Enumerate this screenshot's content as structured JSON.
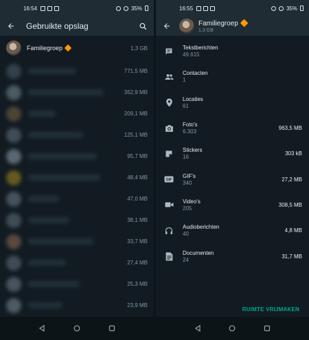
{
  "left": {
    "status_time": "16:54",
    "battery": "35%",
    "title": "Gebruikte opslag",
    "rows": [
      {
        "name": "Familiegroep",
        "emoji": "🔶",
        "size": "1,3 GB"
      },
      {
        "size": "771,5 MB",
        "blur": "#3b4a55"
      },
      {
        "size": "352,9 MB",
        "blur": "#5a6b72"
      },
      {
        "size": "209,1 MB",
        "blur": "#5c4e3a"
      },
      {
        "size": "125,1 MB",
        "blur": "#4c5a63"
      },
      {
        "size": "95,7 MB",
        "blur": "#6d7a86"
      },
      {
        "size": "48,4 MB",
        "blur": "#7a6a1e"
      },
      {
        "size": "47,0 MB",
        "blur": "#54616b"
      },
      {
        "size": "38,1 MB",
        "blur": "#4a5862"
      },
      {
        "size": "33,7 MB",
        "blur": "#6b5446"
      },
      {
        "size": "27,4 MB",
        "blur": "#4b5763"
      },
      {
        "size": "25,3 MB",
        "blur": "#55616c"
      },
      {
        "size": "23,9 MB",
        "blur": "#5c6a74"
      }
    ]
  },
  "right": {
    "status_time": "16:55",
    "battery": "35%",
    "title": "Familiegroep",
    "emoji": "🔶",
    "subtitle": "1,3 GB",
    "items": [
      {
        "icon": "message-icon",
        "label": "Tekstberichten",
        "count": "49.615",
        "size": ""
      },
      {
        "icon": "contacts-icon",
        "label": "Contacten",
        "count": "1",
        "size": ""
      },
      {
        "icon": "location-icon",
        "label": "Locaties",
        "count": "61",
        "size": ""
      },
      {
        "icon": "camera-icon",
        "label": "Foto's",
        "count": "6.303",
        "size": "963,5 MB"
      },
      {
        "icon": "sticker-icon",
        "label": "Stickers",
        "count": "16",
        "size": "303 kB"
      },
      {
        "icon": "gif-icon",
        "label": "GIF's",
        "count": "340",
        "size": "27,2 MB"
      },
      {
        "icon": "video-icon",
        "label": "Video's",
        "count": "205",
        "size": "308,5 MB"
      },
      {
        "icon": "headphones-icon",
        "label": "Audioberichten",
        "count": "40",
        "size": "4,8 MB"
      },
      {
        "icon": "document-icon",
        "label": "Documenten",
        "count": "24",
        "size": "31,7 MB"
      }
    ],
    "free_button": "RUIMTE VRIJMAKEN"
  },
  "colors": {
    "background": "#121b22",
    "bar": "#1f2c34",
    "accent": "#00a884",
    "muted": "#8696a0"
  }
}
